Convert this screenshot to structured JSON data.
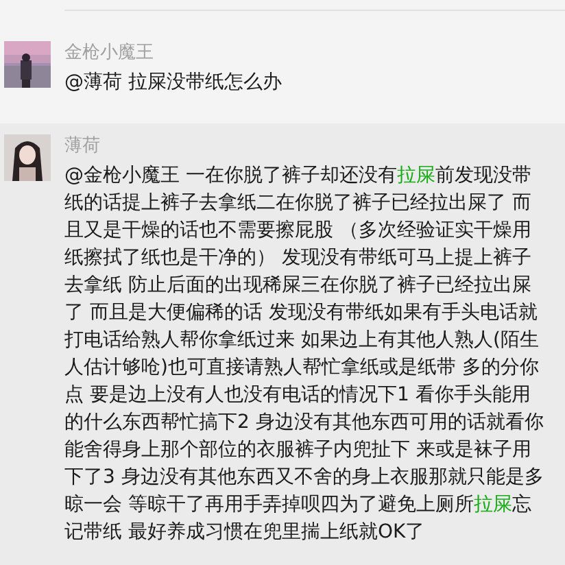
{
  "messages": [
    {
      "sender": "金枪小魔王",
      "selected": false,
      "avatar": {
        "kind": "picture"
      },
      "segments": [
        {
          "kind": "plain",
          "text": "@薄荷 拉屎没带纸怎么办"
        }
      ]
    },
    {
      "sender": "薄荷",
      "selected": true,
      "avatar": {
        "kind": "picture"
      },
      "segments": [
        {
          "kind": "plain",
          "text": "@金枪小魔王 一在你脱了裤子却还没有"
        },
        {
          "kind": "keyword",
          "text": "拉屎"
        },
        {
          "kind": "plain",
          "text": "前发现没带纸的话提上裤子去拿纸二在你脱了裤子已经拉出屎了 而且又是干燥的话也不需要擦屁股 （多次经验证实干燥用纸擦拭了纸也是干净的） 发现没有带纸可马上提上裤子去拿纸 防止后面的出现稀屎三在你脱了裤子已经拉出屎了 而且是大便偏稀的话 发现没有带纸如果有手头电话就打电话给熟人帮你拿纸过来 如果边上有其他人熟人(陌生人估计够呛)也可直接请熟人帮忙拿纸或是纸带 多的分你点 要是边上没有人也没有电话的情况下1 看你手头能用的什么东西帮忙搞下2 身边没有其他东西可用的话就看你能舍得身上那个部位的衣服裤子内兜扯下 来或是袜子用下了3 身边没有其他东西又不舍的身上衣服那就只能是多晾一会 等晾干了再用手弄掉呗四为了避免上厕所"
        },
        {
          "kind": "keyword",
          "text": "拉屎"
        },
        {
          "kind": "plain",
          "text": "忘记带纸 最好养成习惯在兜里揣上纸就OK了"
        }
      ]
    }
  ]
}
